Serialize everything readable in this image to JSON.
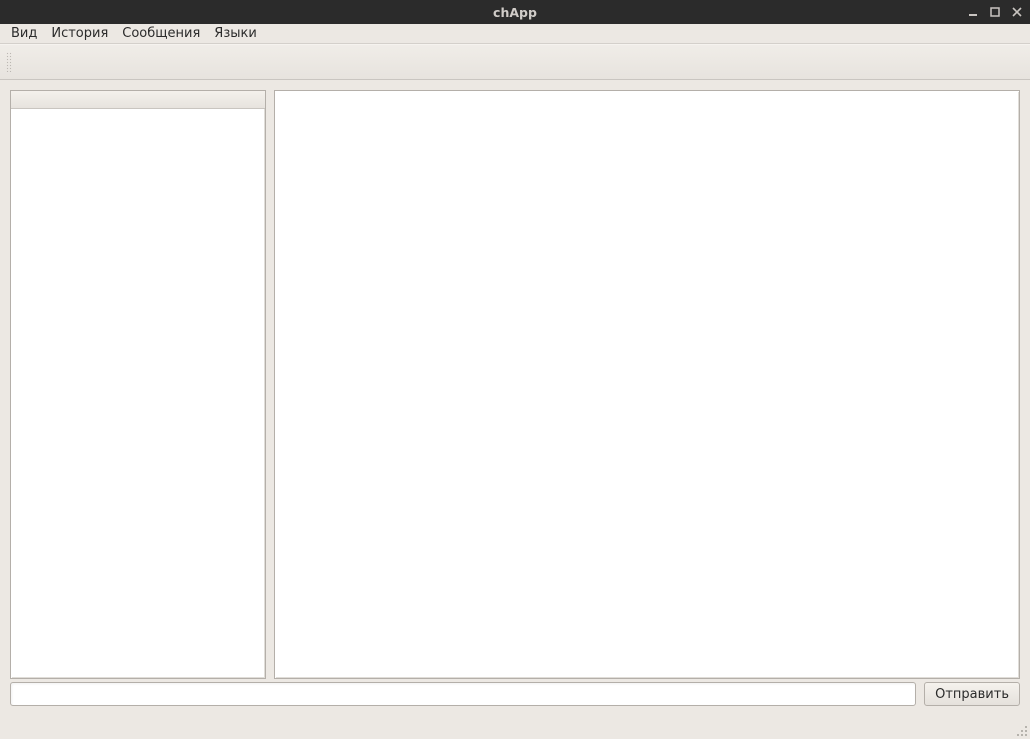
{
  "window": {
    "title": "chApp"
  },
  "menu": {
    "view": "Вид",
    "history": "История",
    "messages": "Сообщения",
    "languages": "Языки"
  },
  "input": {
    "value": "",
    "placeholder": ""
  },
  "buttons": {
    "send": "Отправить"
  }
}
